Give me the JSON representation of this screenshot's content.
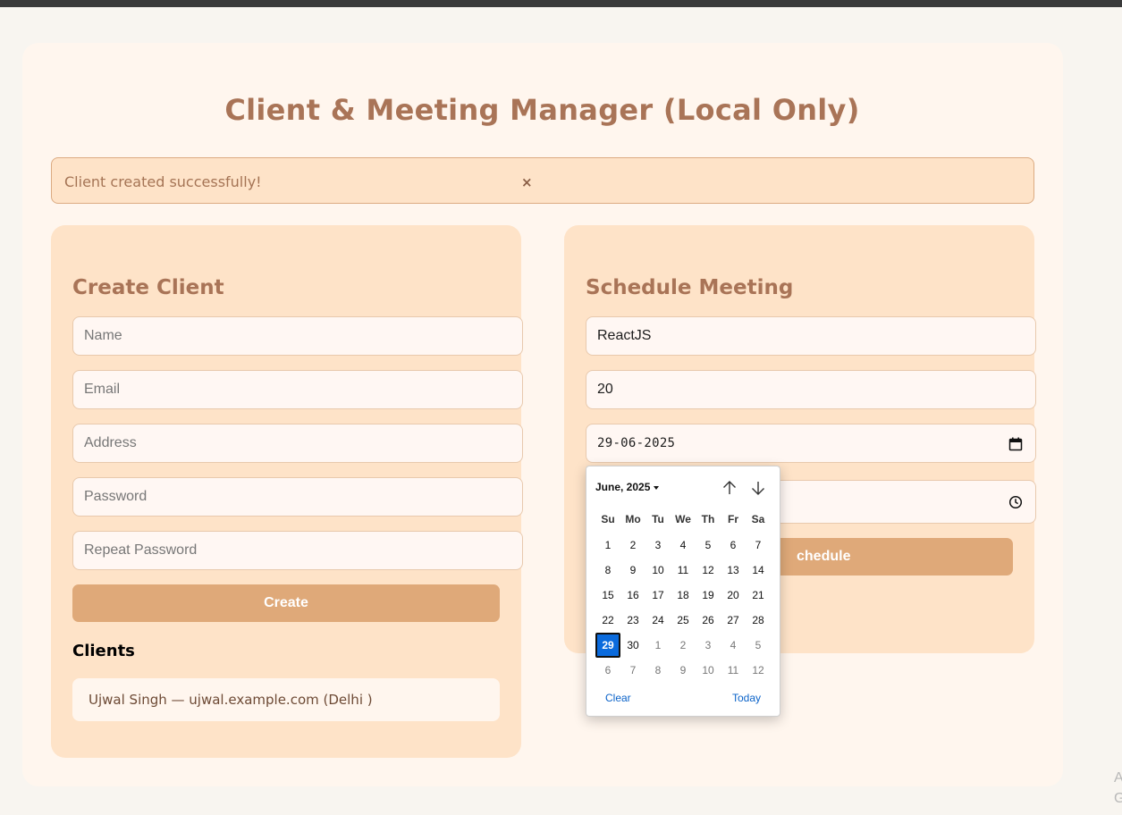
{
  "page": {
    "title": "Client & Meeting Manager (Local Only)"
  },
  "alert": {
    "message": "Client created successfully!",
    "close_glyph": "×"
  },
  "create_client": {
    "heading": "Create Client",
    "fields": {
      "name_placeholder": "Name",
      "email_placeholder": "Email",
      "address_placeholder": "Address",
      "password_placeholder": "Password",
      "repeat_password_placeholder": "Repeat Password"
    },
    "button_label": "Create",
    "clients_heading": "Clients",
    "clients": [
      {
        "text": "Ujwal Singh — ujwal.example.com (Delhi )"
      }
    ]
  },
  "schedule_meeting": {
    "heading": "Schedule Meeting",
    "topic_value": "ReactJS",
    "participants_value": "20",
    "date_value": "29-06-2025",
    "button_label": "Schedule",
    "button_visible_label": "chedule"
  },
  "datepicker": {
    "month_label": "June, 2025",
    "weekdays": [
      "Su",
      "Mo",
      "Tu",
      "We",
      "Th",
      "Fr",
      "Sa"
    ],
    "weeks": [
      [
        "1",
        "2",
        "3",
        "4",
        "5",
        "6",
        "7"
      ],
      [
        "8",
        "9",
        "10",
        "11",
        "12",
        "13",
        "14"
      ],
      [
        "15",
        "16",
        "17",
        "18",
        "19",
        "20",
        "21"
      ],
      [
        "22",
        "23",
        "24",
        "25",
        "26",
        "27",
        "28"
      ],
      [
        "29",
        "30",
        "1",
        "2",
        "3",
        "4",
        "5"
      ],
      [
        "6",
        "7",
        "8",
        "9",
        "10",
        "11",
        "12"
      ]
    ],
    "selected_day": "29",
    "clear_label": "Clear",
    "today_label": "Today"
  },
  "corner": {
    "line1": "A",
    "line2": "G"
  },
  "colors": {
    "accent": "#a97457",
    "panel": "#fee3c8",
    "button": "#dfa979",
    "selected_day": "#0b6bdd"
  }
}
